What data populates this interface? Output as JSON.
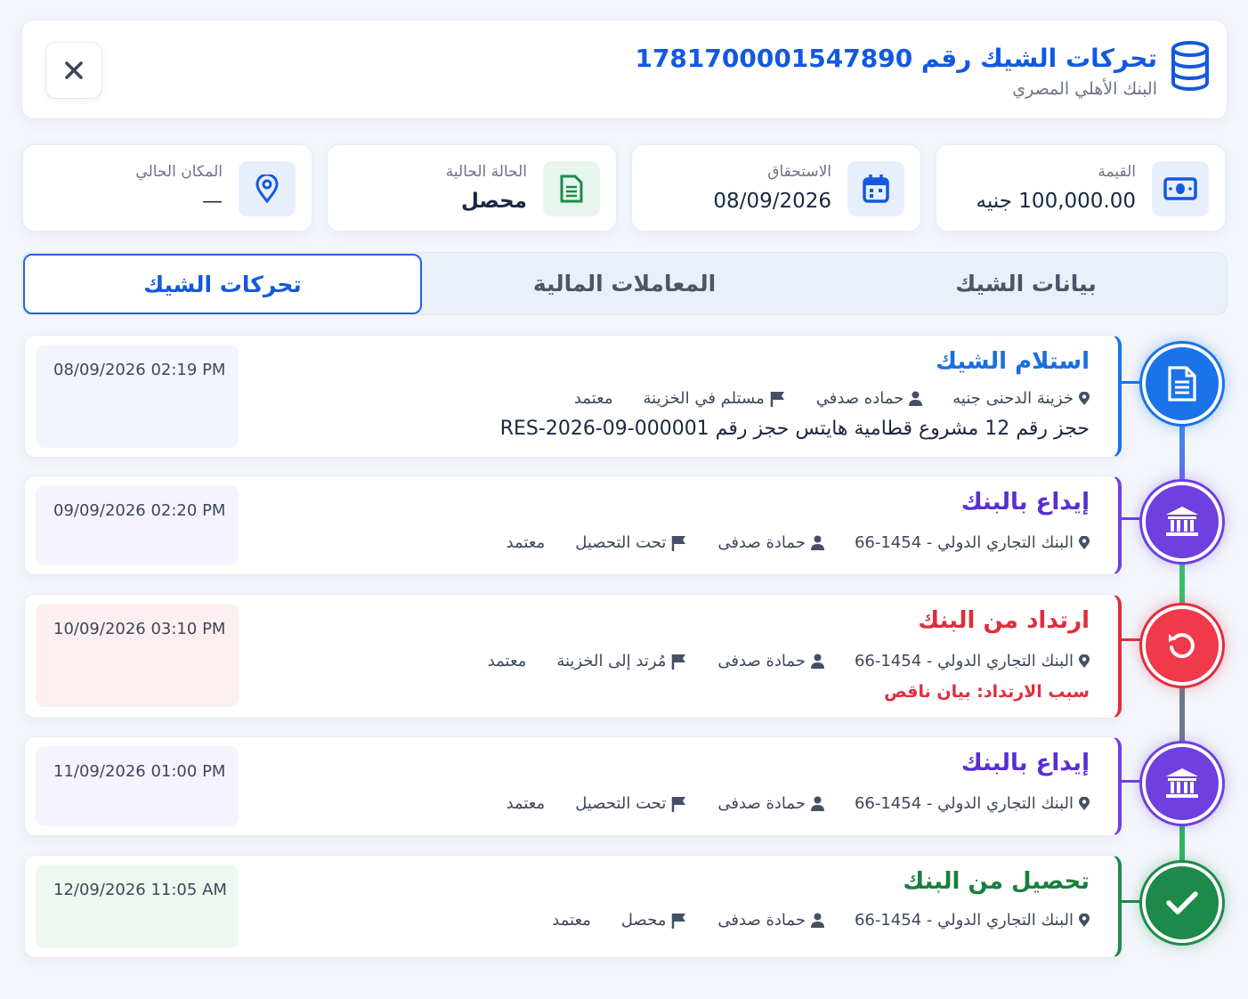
{
  "header": {
    "title": "تحركات الشيك رقم 1781700001547890",
    "subtitle": "البنك الأهلي المصري",
    "icon": "database-icon",
    "close_icon": "close-icon"
  },
  "stats": {
    "value": {
      "label": "القيمة",
      "value": "100,000.00 جنيه",
      "icon": "money-icon"
    },
    "due": {
      "label": "الاستحقاق",
      "value": "08/09/2026",
      "icon": "calendar-icon"
    },
    "status": {
      "label": "الحالة الحالية",
      "value": "محصل",
      "icon": "document-icon"
    },
    "location": {
      "label": "المكان الحالي",
      "value": "—",
      "icon": "location-pin-icon"
    }
  },
  "tabs": [
    {
      "label": "بيانات الشيك",
      "active": false
    },
    {
      "label": "المعاملات المالية",
      "active": false
    },
    {
      "label": "تحركات الشيك",
      "active": true
    }
  ],
  "events": [
    {
      "title": "استلام الشيك",
      "color": "#1a73e8",
      "icon": "document-icon",
      "location": "خزينة الدحنى جنيه",
      "user": "حماده صدفي",
      "status": "مستلم في الخزينة",
      "approval": "معتمد",
      "note": "حجز رقم 12 مشروع قطامية هايتس حجز رقم RES-2026-09-000001",
      "timestamp": "08/09/2026 02:19 PM"
    },
    {
      "title": "إيداع بالبنك",
      "color": "#6f3fe0",
      "icon": "bank-icon",
      "location": "البنك التجاري الدولي - 1454-66",
      "user": "حمادة صدفى",
      "status": "تحت التحصيل",
      "approval": "معتمد",
      "timestamp": "09/09/2026 02:20 PM"
    },
    {
      "title": "ارتداد من البنك",
      "color": "#e02d3c",
      "icon": "undo-icon",
      "location": "البنك التجاري الدولي - 1454-66",
      "user": "حمادة صدفى",
      "status": "مُرتد إلى الخزينة",
      "approval": "معتمد",
      "reason_label": "سبب الارتداد:",
      "reason": "بيان ناقص",
      "timestamp": "10/09/2026 03:10 PM"
    },
    {
      "title": "إيداع بالبنك",
      "color": "#6f3fe0",
      "icon": "bank-icon",
      "location": "البنك التجاري الدولي - 1454-66",
      "user": "حمادة صدفى",
      "status": "تحت التحصيل",
      "approval": "معتمد",
      "timestamp": "11/09/2026 01:00 PM"
    },
    {
      "title": "تحصيل من البنك",
      "color": "#1e8a4a",
      "icon": "check-icon",
      "location": "البنك التجاري الدولي - 1454-66",
      "user": "حمادة صدفى",
      "status": "محصل",
      "approval": "معتمد",
      "timestamp": "12/09/2026 11:05 AM"
    }
  ],
  "colors": {
    "primary": "#1358e0",
    "purple": "#6f3fe0",
    "red": "#e02d3c",
    "green": "#1e8a4a"
  }
}
